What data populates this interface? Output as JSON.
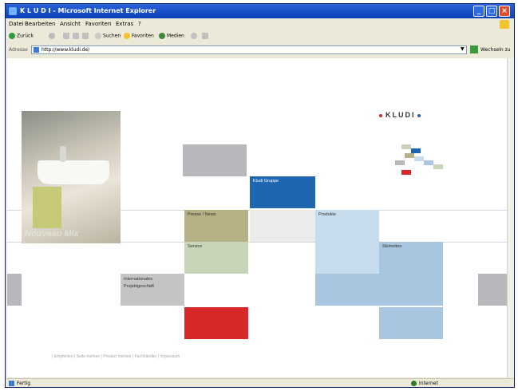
{
  "window": {
    "title": "K L U D I - Microsoft Internet Explorer"
  },
  "menu": [
    "Datei",
    "Bearbeiten",
    "Ansicht",
    "Favoriten",
    "Extras",
    "?"
  ],
  "toolbar": {
    "back": "Zurück",
    "search": "Suchen",
    "favorites": "Favoriten",
    "media": "Medien"
  },
  "address": {
    "label": "Adresse",
    "url": "http://www.kludi.de/",
    "go_label": "Wechseln zu"
  },
  "brand": {
    "logo": "KLUDI",
    "product_name": "Nouveau Mix"
  },
  "nav": {
    "kludi_gruppe": "Kludi Gruppe",
    "presse_news": "Presse / News",
    "produkte": "Produkte",
    "service": "Service",
    "skimetten": "Skimetten",
    "internationales": "Internationales Projektgeschäft"
  },
  "footer": [
    "Empfehlen",
    "Seite merken",
    "Product merken",
    "Fachhändler",
    "Impressum"
  ],
  "status": {
    "left": "Fertig",
    "right": "Internet"
  },
  "colors": {
    "blue": "#1f66b0",
    "red": "#d8282a",
    "khaki": "#b6b184",
    "sage": "#c9d5b9",
    "light_blue": "#c7dcec",
    "mid_blue": "#a8c6e0",
    "gray": "#b8b8bc"
  }
}
